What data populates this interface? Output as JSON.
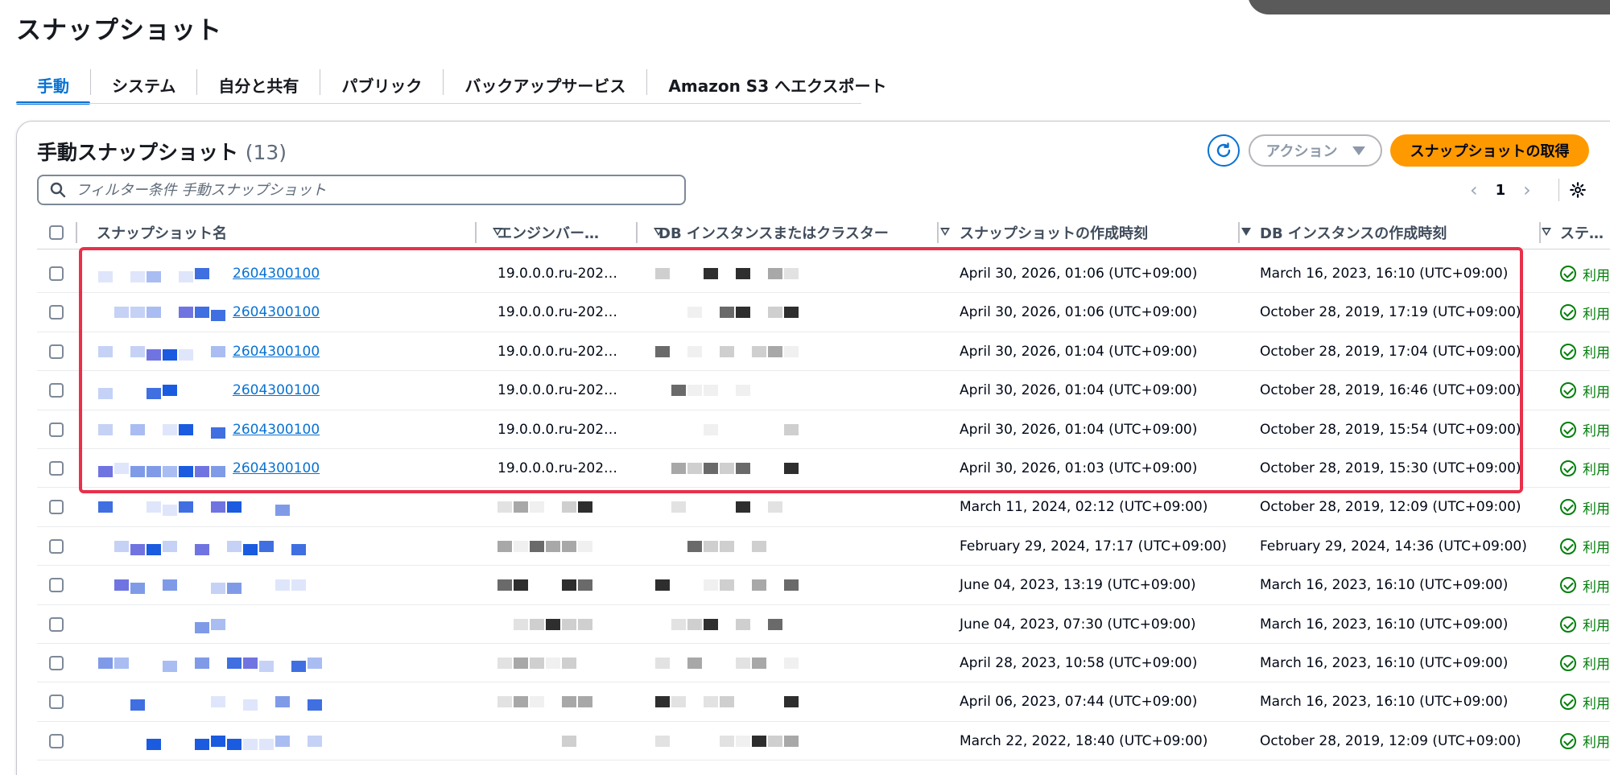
{
  "page": {
    "title": "スナップショット"
  },
  "tabs": [
    {
      "label": "手動",
      "active": true
    },
    {
      "label": "システム",
      "active": false
    },
    {
      "label": "自分と共有",
      "active": false
    },
    {
      "label": "パブリック",
      "active": false
    },
    {
      "label": "バックアップサービス",
      "active": false
    },
    {
      "label": "Amazon S3 へエクスポート",
      "active": false
    }
  ],
  "container": {
    "title": "手動スナップショット",
    "count": "(13)",
    "refresh_icon": "refresh-icon",
    "actions_label": "アクション",
    "primary_label": "スナップショットの取得",
    "filter_placeholder": "フィルター条件 手動スナップショット",
    "page_number": "1"
  },
  "columns": {
    "name": "スナップショット名",
    "engine": "エンジンバー…",
    "instance": "DB インスタンスまたはクラスター",
    "created": "スナップショットの作成時刻",
    "instance_created": "DB インスタンスの作成時刻",
    "status": "ステ…"
  },
  "rows": [
    {
      "name": "2604300100",
      "engine": "19.0.0.0.ru-202…",
      "created": "April 30, 2026, 01:06 (UTC+09:00)",
      "instance_created": "March 16, 2023, 16:10 (UTC+09:00)",
      "status": "利用"
    },
    {
      "name": "2604300100",
      "engine": "19.0.0.0.ru-202…",
      "created": "April 30, 2026, 01:06 (UTC+09:00)",
      "instance_created": "October 28, 2019, 17:19 (UTC+09:00)",
      "status": "利用"
    },
    {
      "name": "2604300100",
      "engine": "19.0.0.0.ru-202…",
      "created": "April 30, 2026, 01:04 (UTC+09:00)",
      "instance_created": "October 28, 2019, 17:04 (UTC+09:00)",
      "status": "利用"
    },
    {
      "name": "2604300100",
      "engine": "19.0.0.0.ru-202…",
      "created": "April 30, 2026, 01:04 (UTC+09:00)",
      "instance_created": "October 28, 2019, 16:46 (UTC+09:00)",
      "status": "利用"
    },
    {
      "name": "2604300100",
      "engine": "19.0.0.0.ru-202…",
      "created": "April 30, 2026, 01:04 (UTC+09:00)",
      "instance_created": "October 28, 2019, 15:54 (UTC+09:00)",
      "status": "利用"
    },
    {
      "name": "2604300100",
      "engine": "19.0.0.0.ru-202…",
      "created": "April 30, 2026, 01:03 (UTC+09:00)",
      "instance_created": "October 28, 2019, 15:30 (UTC+09:00)",
      "status": "利用"
    },
    {
      "name": "",
      "engine": "",
      "created": "March 11, 2024, 02:12 (UTC+09:00)",
      "instance_created": "October 28, 2019, 12:09 (UTC+09:00)",
      "status": "利用"
    },
    {
      "name": "",
      "engine": "",
      "created": "February 29, 2024, 17:17 (UTC+09:00)",
      "instance_created": "February 29, 2024, 14:36 (UTC+09:00)",
      "status": "利用"
    },
    {
      "name": "",
      "engine": "",
      "created": "June 04, 2023, 13:19 (UTC+09:00)",
      "instance_created": "March 16, 2023, 16:10 (UTC+09:00)",
      "status": "利用"
    },
    {
      "name": "",
      "engine": "",
      "created": "June 04, 2023, 07:30 (UTC+09:00)",
      "instance_created": "March 16, 2023, 16:10 (UTC+09:00)",
      "status": "利用"
    },
    {
      "name": "",
      "engine": "",
      "created": "April 28, 2023, 10:58 (UTC+09:00)",
      "instance_created": "March 16, 2023, 16:10 (UTC+09:00)",
      "status": "利用"
    },
    {
      "name": "",
      "engine": "",
      "created": "April 06, 2023, 07:44 (UTC+09:00)",
      "instance_created": "March 16, 2023, 16:10 (UTC+09:00)",
      "status": "利用"
    },
    {
      "name": "",
      "engine": "",
      "created": "March 22, 2022, 18:40 (UTC+09:00)",
      "instance_created": "October 28, 2019, 12:09 (UTC+09:00)",
      "status": "利用"
    }
  ],
  "colors": {
    "accent": "#0972d3",
    "primary": "#ff9900",
    "success": "#037f0c",
    "highlight": "#e8304a"
  }
}
